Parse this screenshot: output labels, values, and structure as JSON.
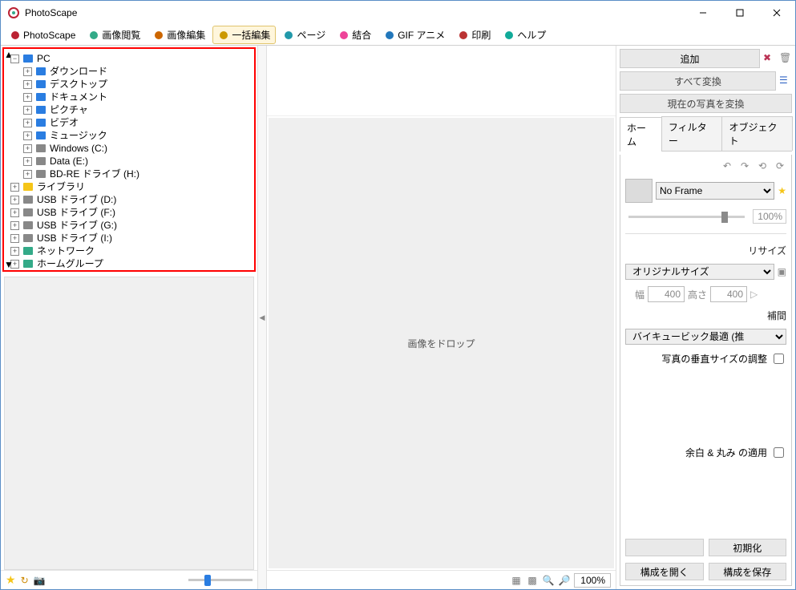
{
  "window": {
    "title": "PhotoScape"
  },
  "menu": {
    "items": [
      {
        "label": "PhotoScape",
        "icon": "photoscape"
      },
      {
        "label": "画像閲覧",
        "icon": "viewer"
      },
      {
        "label": "画像編集",
        "icon": "editor"
      },
      {
        "label": "一括編集",
        "icon": "batch",
        "active": true
      },
      {
        "label": "ページ",
        "icon": "page"
      },
      {
        "label": "結合",
        "icon": "combine"
      },
      {
        "label": "GIF アニメ",
        "icon": "gif"
      },
      {
        "label": "印刷",
        "icon": "print"
      },
      {
        "label": "ヘルプ",
        "icon": "help"
      }
    ]
  },
  "tree": {
    "root": {
      "label": "PC",
      "expanded": true
    },
    "pc_children": [
      {
        "label": "ダウンロード",
        "icon": "download"
      },
      {
        "label": "デスクトップ",
        "icon": "desktop"
      },
      {
        "label": "ドキュメント",
        "icon": "docs"
      },
      {
        "label": "ピクチャ",
        "icon": "pics"
      },
      {
        "label": "ビデオ",
        "icon": "video"
      },
      {
        "label": "ミュージック",
        "icon": "music"
      },
      {
        "label": "Windows (C:)",
        "icon": "drive"
      },
      {
        "label": "Data (E:)",
        "icon": "drive"
      },
      {
        "label": "BD-RE ドライブ (H:)",
        "icon": "optical"
      }
    ],
    "siblings": [
      {
        "label": "ライブラリ",
        "icon": "library"
      },
      {
        "label": "USB ドライブ (D:)",
        "icon": "drive"
      },
      {
        "label": "USB ドライブ (F:)",
        "icon": "drive"
      },
      {
        "label": "USB ドライブ (G:)",
        "icon": "drive"
      },
      {
        "label": "USB ドライブ (I:)",
        "icon": "drive"
      },
      {
        "label": "ネットワーク",
        "icon": "network"
      },
      {
        "label": "ホームグループ",
        "icon": "homegroup"
      }
    ]
  },
  "canvas": {
    "drop_text": "画像をドロップ"
  },
  "cbar": {
    "zoom": "100%"
  },
  "right": {
    "add": "追加",
    "convert_all": "すべて変換",
    "convert_current": "現在の写真を変換",
    "tabs": [
      "ホーム",
      "フィルター",
      "オブジェクト"
    ],
    "frame_option": "No Frame",
    "opacity": "100%",
    "resize_label": "リサイズ",
    "resize_option": "オリジナルサイズ",
    "width_label": "幅",
    "width_val": "400",
    "height_label": "高さ",
    "height_val": "400",
    "interp_label": "補間",
    "interp_option": "バイキュービック最適 (推",
    "vertical_adjust": "写真の垂直サイズの調整",
    "margin_round": "余白 & 丸み の適用",
    "reset": "初期化",
    "open_config": "構成を開く",
    "save_config": "構成を保存"
  }
}
